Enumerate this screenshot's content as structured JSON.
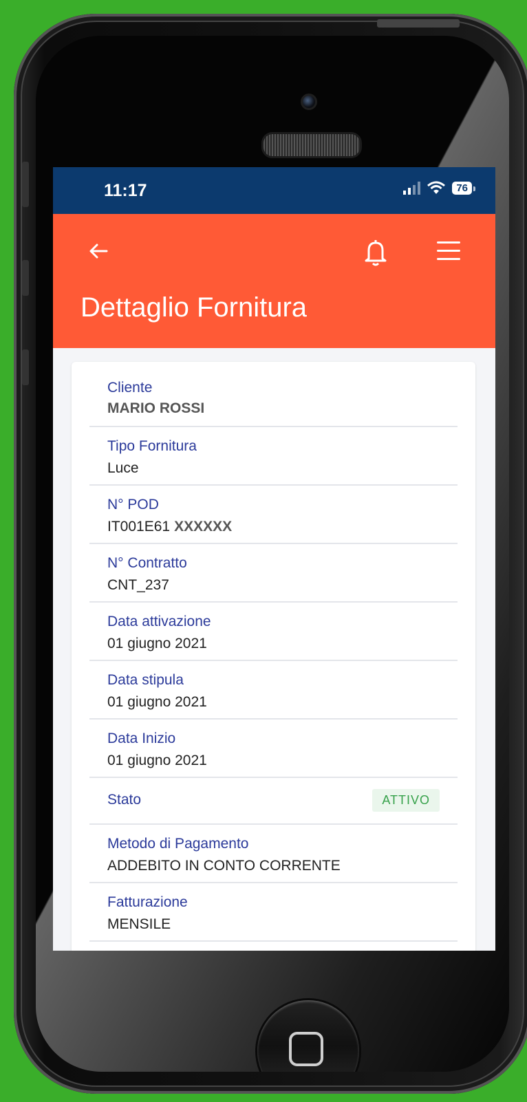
{
  "status_bar": {
    "time": "11:17",
    "battery": "76"
  },
  "header": {
    "title": "Dettaglio Fornitura"
  },
  "fields": [
    {
      "label": "Cliente",
      "value": "MARIO ROSSI"
    },
    {
      "label": "Tipo Fornitura",
      "value": "Luce"
    },
    {
      "label": "N° POD",
      "value": "IT001E61",
      "value_masked": "XXXXXX"
    },
    {
      "label": "N° Contratto",
      "value": "CNT_237"
    },
    {
      "label": "Data attivazione",
      "value": "01 giugno 2021"
    },
    {
      "label": "Data stipula",
      "value": "01 giugno 2021"
    },
    {
      "label": "Data Inizio",
      "value": "01 giugno 2021"
    },
    {
      "label": "Stato",
      "badge": "ATTIVO"
    },
    {
      "label": "Metodo di Pagamento",
      "value": "ADDEBITO IN CONTO CORRENTE"
    },
    {
      "label": "Fatturazione",
      "value": "MENSILE"
    }
  ],
  "colors": {
    "status_bar": "#0c3a6e",
    "app_bar": "#ff5a36",
    "label": "#2b3a9a",
    "badge": "#36a14a",
    "background": "#3aae2a"
  }
}
